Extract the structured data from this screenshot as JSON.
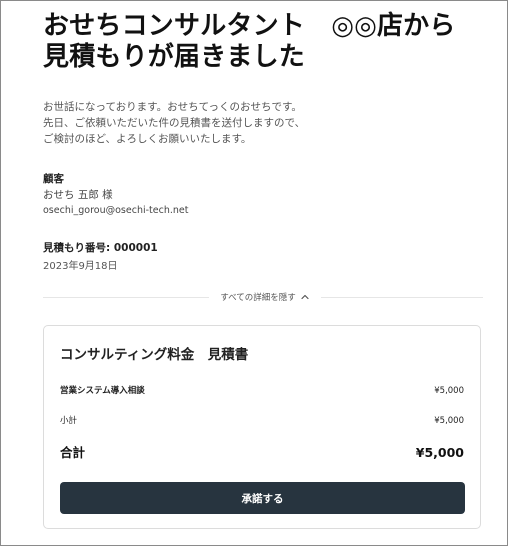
{
  "header": {
    "title_line1": "おせちコンサルタント　◎◎店から",
    "title_line2": "見積もりが届きました"
  },
  "intro": {
    "line1": "お世話になっております。おせちてっくのおせちです。",
    "line2": "先日、ご依頼いただいた件の見積書を送付しますので、",
    "line3": "ご検討のほど、よろしくお願いいたします。"
  },
  "customer": {
    "label": "顧客",
    "name": "おせち 五郎 様",
    "email": "osechi_gorou@osechi-tech.net"
  },
  "quote": {
    "number_label": "見積もり番号: 000001",
    "date": "2023年9月18日"
  },
  "details_toggle": {
    "label": "すべての詳細を隠す",
    "icon": "chevron-up-icon"
  },
  "card": {
    "title": "コンサルティング料金　見積書",
    "items": [
      {
        "name": "営業システム導入相談",
        "price": "¥5,000"
      }
    ],
    "subtotal_label": "小計",
    "subtotal_value": "¥5,000",
    "total_label": "合計",
    "total_value": "¥5,000",
    "accept_label": "承諾する"
  },
  "colors": {
    "button_bg": "#27343f",
    "button_text": "#ffffff"
  }
}
